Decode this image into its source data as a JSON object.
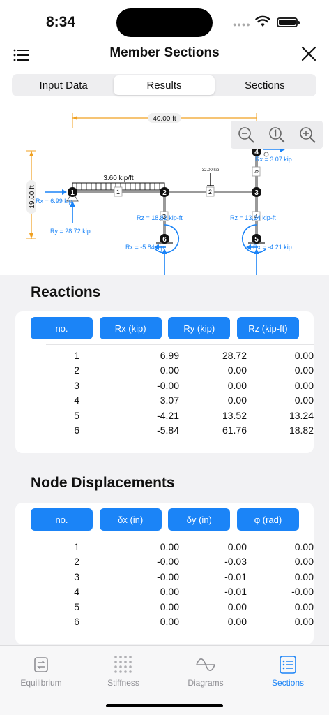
{
  "status": {
    "time": "8:34"
  },
  "nav": {
    "title": "Member Sections"
  },
  "segments": [
    {
      "label": "Input Data",
      "active": false
    },
    {
      "label": "Results",
      "active": true
    },
    {
      "label": "Sections",
      "active": false
    }
  ],
  "diagram": {
    "span_label": "40.00 ft",
    "height_label": "19.00 ft",
    "distributed_load": "3.60 kip/ft",
    "point_load": "32.00 kip",
    "reaction_rx1": "Rx = 6.99 kip",
    "reaction_ry1": "Ry = 28.72 kip",
    "reaction_rz6": "Rz = 18.82 kip-ft",
    "reaction_rx6": "Rx = -5.84 kip",
    "reaction_rz5": "Rz = 13.24 kip-ft",
    "reaction_rx5": "Rx = -4.21 kip",
    "reaction_rx4": "Rx = 3.07 kip",
    "nodes": [
      "1",
      "2",
      "3",
      "4",
      "5",
      "6"
    ],
    "members": [
      "1",
      "2",
      "3",
      "4",
      "5"
    ]
  },
  "reactions": {
    "title": "Reactions",
    "headers": [
      "no.",
      "Rx (kip)",
      "Ry (kip)",
      "Rz (kip-ft)"
    ],
    "rows": [
      [
        "1",
        "6.99",
        "28.72",
        "0.00"
      ],
      [
        "2",
        "0.00",
        "0.00",
        "0.00"
      ],
      [
        "3",
        "-0.00",
        "0.00",
        "0.00"
      ],
      [
        "4",
        "3.07",
        "0.00",
        "0.00"
      ],
      [
        "5",
        "-4.21",
        "13.52",
        "13.24"
      ],
      [
        "6",
        "-5.84",
        "61.76",
        "18.82"
      ]
    ]
  },
  "displacements": {
    "title": "Node Displacements",
    "headers": [
      "no.",
      "δx (in)",
      "δy (in)",
      "φ (rad)"
    ],
    "rows": [
      [
        "1",
        "0.00",
        "0.00",
        "0.00"
      ],
      [
        "2",
        "-0.00",
        "-0.03",
        "0.00"
      ],
      [
        "3",
        "-0.00",
        "-0.01",
        "0.00"
      ],
      [
        "4",
        "0.00",
        "-0.01",
        "-0.00"
      ],
      [
        "5",
        "0.00",
        "0.00",
        "0.00"
      ],
      [
        "6",
        "0.00",
        "0.00",
        "0.00"
      ]
    ]
  },
  "tabs": [
    {
      "label": "Equilibrium",
      "icon": "equilibrium-icon",
      "active": false
    },
    {
      "label": "Stiffness",
      "icon": "stiffness-grid-icon",
      "active": false
    },
    {
      "label": "Diagrams",
      "icon": "wave-icon",
      "active": false
    },
    {
      "label": "Sections",
      "icon": "sections-list-icon",
      "active": true
    }
  ],
  "colors": {
    "accent": "#1b84f7",
    "dimension": "#f0a020"
  }
}
